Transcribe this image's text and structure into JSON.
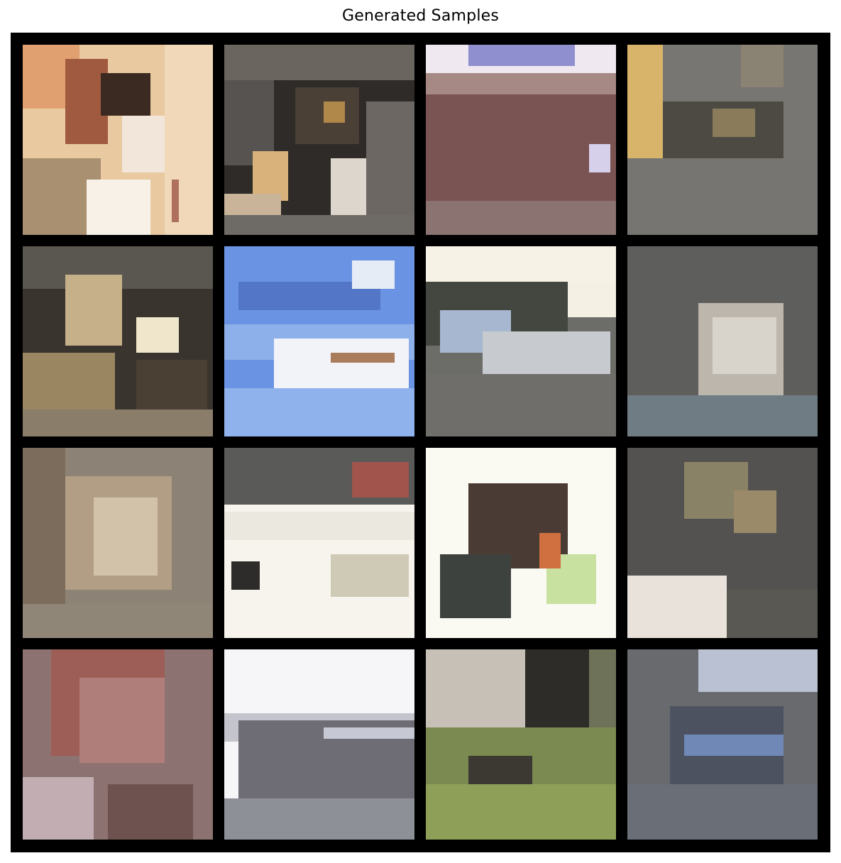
{
  "title": "Generated Samples",
  "grid": {
    "rows": 4,
    "cols": 4,
    "background_color": "#000000"
  },
  "samples": [
    {
      "label": "",
      "base_color": "#e8c9a0"
    },
    {
      "label": "",
      "base_color": "#3a3530"
    },
    {
      "label": "",
      "base_color": "#8a6664"
    },
    {
      "label": "",
      "base_color": "#797775"
    },
    {
      "label": "",
      "base_color": "#4a4238"
    },
    {
      "label": "",
      "base_color": "#6c93e0"
    },
    {
      "label": "",
      "base_color": "#6c6c68"
    },
    {
      "label": "",
      "base_color": "#5f5f5d"
    },
    {
      "label": "",
      "base_color": "#8f8579"
    },
    {
      "label": "",
      "base_color": "#e6e4dc"
    },
    {
      "label": "",
      "base_color": "#f6f5ee"
    },
    {
      "label": "",
      "base_color": "#585650"
    },
    {
      "label": "",
      "base_color": "#8c7270"
    },
    {
      "label": "",
      "base_color": "#8e909a"
    },
    {
      "label": "",
      "base_color": "#6e7258"
    },
    {
      "label": "",
      "base_color": "#6a6c72"
    }
  ]
}
